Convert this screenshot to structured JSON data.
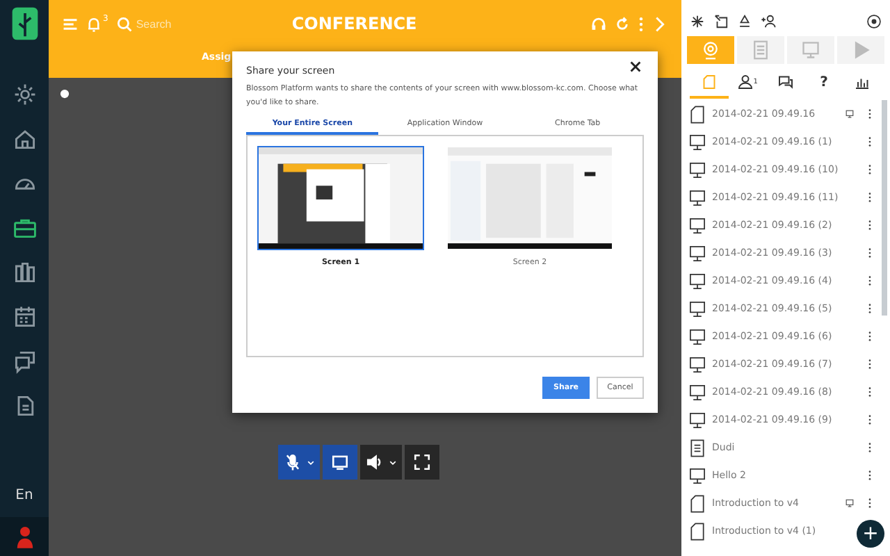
{
  "sidebar": {
    "items": [
      {
        "kind": "gear",
        "selected": false
      },
      {
        "kind": "home",
        "selected": false
      },
      {
        "kind": "gauge",
        "selected": false
      },
      {
        "kind": "briefcase",
        "selected": true
      },
      {
        "kind": "books",
        "selected": false
      },
      {
        "kind": "calendar",
        "selected": false
      },
      {
        "kind": "chat",
        "selected": false
      },
      {
        "kind": "document",
        "selected": false
      }
    ],
    "language": "En"
  },
  "header": {
    "notifications": "3",
    "search": {
      "placeholder": "Search"
    },
    "title": "CONFERENCE",
    "tab": "Assig"
  },
  "dialog": {
    "title": "Share your screen",
    "message": "Blossom Platform wants to share the contents of your screen with www.blossom-kc.com. Choose what you'd like to share.",
    "tabs": [
      {
        "label": "Your Entire Screen",
        "selected": true
      },
      {
        "label": "Application Window",
        "selected": false
      },
      {
        "label": "Chrome Tab",
        "selected": false
      }
    ],
    "screens": [
      {
        "label": "Screen 1",
        "selected": true
      },
      {
        "label": "Screen 2",
        "selected": false
      }
    ],
    "buttons": [
      {
        "label": "Share",
        "kind": "primary"
      },
      {
        "label": "Cancel",
        "kind": "secondary"
      }
    ]
  },
  "controls": [
    {
      "kind": "mic",
      "active": true,
      "dropdown": true
    },
    {
      "kind": "screen",
      "active": true,
      "dropdown": false
    },
    {
      "kind": "speaker",
      "active": false,
      "dropdown": true
    },
    {
      "kind": "fullscreen",
      "active": false,
      "dropdown": false
    }
  ],
  "panel": {
    "modes": [
      {
        "kind": "webcam",
        "selected": true
      },
      {
        "kind": "document",
        "selected": false
      },
      {
        "kind": "monitor",
        "selected": false
      },
      {
        "kind": "play",
        "selected": false
      }
    ],
    "subtabs": [
      {
        "kind": "files",
        "selected": true
      },
      {
        "kind": "people",
        "selected": false,
        "badge": "1"
      },
      {
        "kind": "chat",
        "selected": false
      },
      {
        "kind": "help",
        "selected": false,
        "text": "?"
      },
      {
        "kind": "stats",
        "selected": false
      }
    ],
    "files": [
      {
        "name": "2014-02-21 09.49.16",
        "kind": "document",
        "shared": true
      },
      {
        "name": "2014-02-21 09.49.16 (1)",
        "kind": "presentation",
        "shared": false
      },
      {
        "name": "2014-02-21 09.49.16 (10)",
        "kind": "presentation",
        "shared": false
      },
      {
        "name": "2014-02-21 09.49.16 (11)",
        "kind": "presentation",
        "shared": false
      },
      {
        "name": "2014-02-21 09.49.16 (2)",
        "kind": "presentation",
        "shared": false
      },
      {
        "name": "2014-02-21 09.49.16 (3)",
        "kind": "presentation",
        "shared": false
      },
      {
        "name": "2014-02-21 09.49.16 (4)",
        "kind": "presentation",
        "shared": false
      },
      {
        "name": "2014-02-21 09.49.16 (5)",
        "kind": "presentation",
        "shared": false
      },
      {
        "name": "2014-02-21 09.49.16 (6)",
        "kind": "presentation",
        "shared": false
      },
      {
        "name": "2014-02-21 09.49.16 (7)",
        "kind": "presentation",
        "shared": false
      },
      {
        "name": "2014-02-21 09.49.16 (8)",
        "kind": "presentation",
        "shared": false
      },
      {
        "name": "2014-02-21 09.49.16 (9)",
        "kind": "presentation",
        "shared": false
      },
      {
        "name": "Dudi",
        "kind": "text",
        "shared": false
      },
      {
        "name": "Hello 2",
        "kind": "presentation",
        "shared": false
      },
      {
        "name": "Introduction to v4",
        "kind": "document",
        "shared": true
      },
      {
        "name": "Introduction to v4 (1)",
        "kind": "document",
        "shared": false
      }
    ],
    "add_button": "+"
  }
}
